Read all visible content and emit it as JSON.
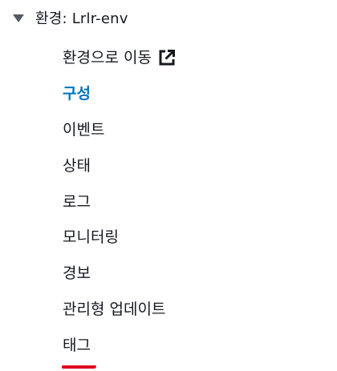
{
  "environment": {
    "title": "환경: Lrlr-env",
    "expanded": true
  },
  "nav": {
    "items": [
      {
        "label": "환경으로 이동",
        "icon": "external-link-icon"
      },
      {
        "label": "구성",
        "active": true,
        "highlighted": true
      },
      {
        "label": "이벤트"
      },
      {
        "label": "상태",
        "highlighted": true
      },
      {
        "label": "로그",
        "highlighted": true
      },
      {
        "label": "모니터링"
      },
      {
        "label": "경보"
      },
      {
        "label": "관리형 업데이트"
      },
      {
        "label": "태그"
      }
    ]
  },
  "colors": {
    "active_link": "#0073bb",
    "highlight_underline": "#e0001b",
    "text": "#16191f",
    "caret": "#545b64"
  }
}
